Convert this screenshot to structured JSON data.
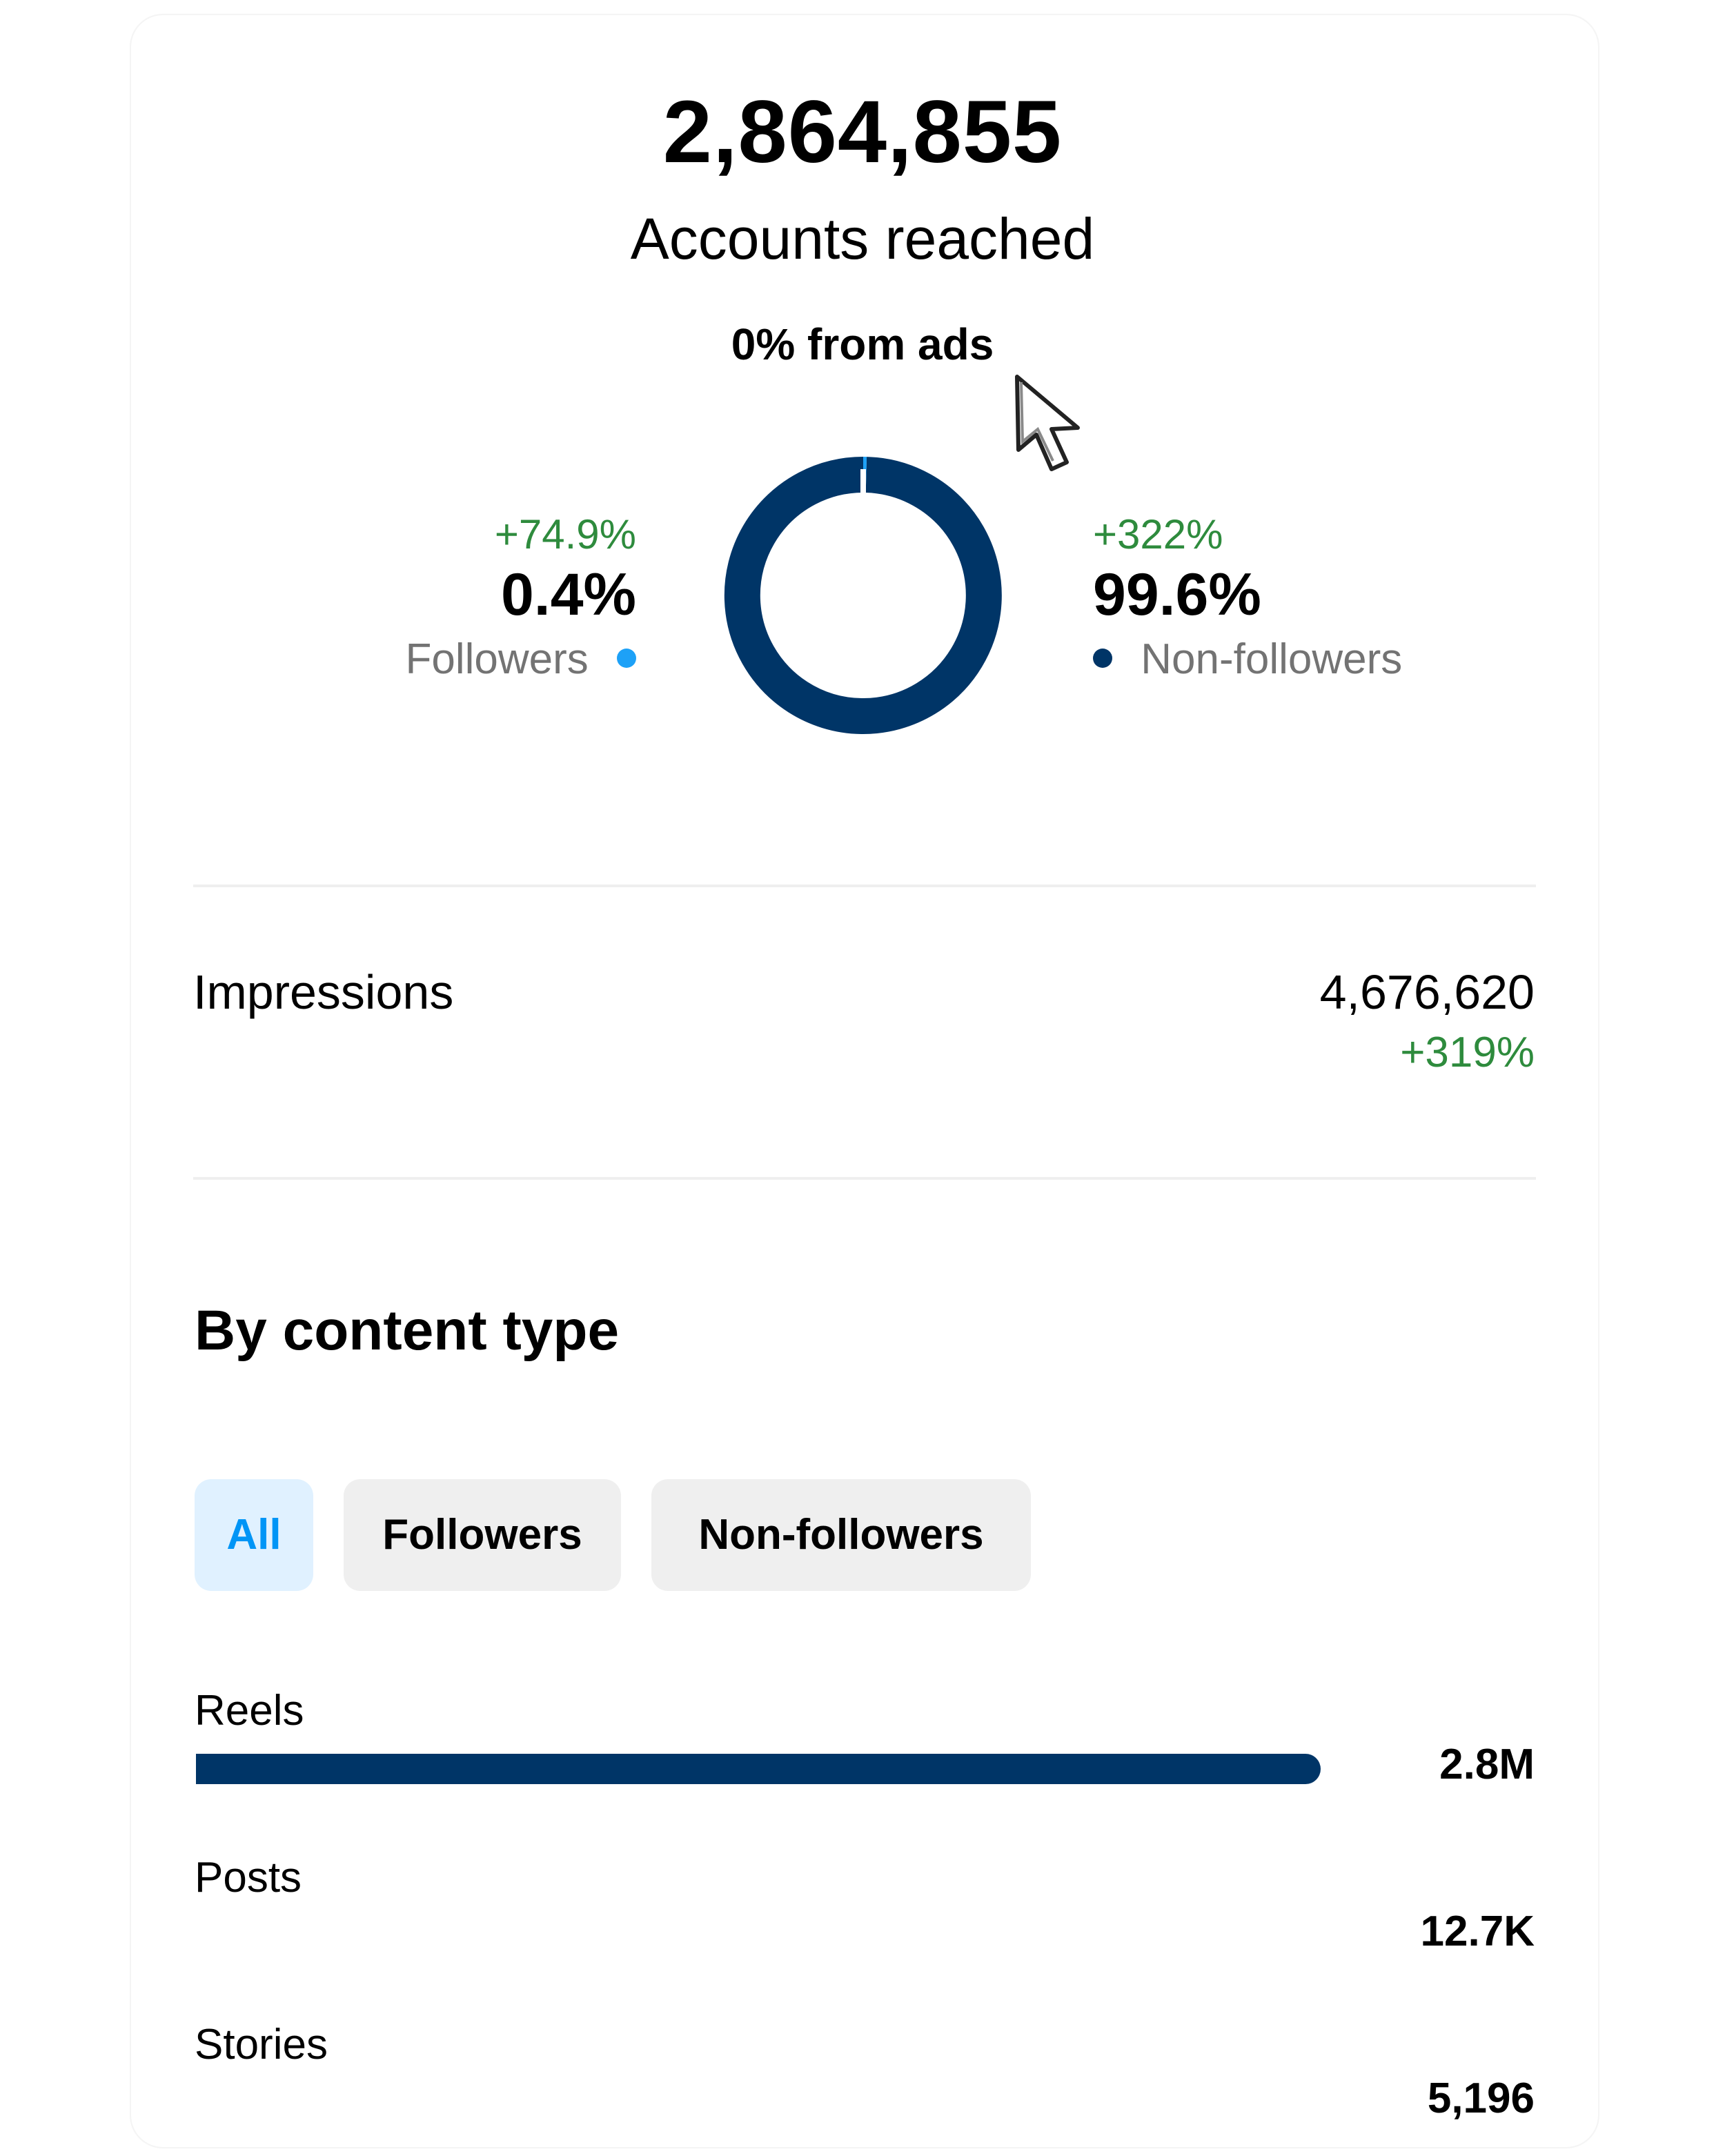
{
  "summary": {
    "accounts_reached_value": "2,864,855",
    "accounts_reached_label": "Accounts reached",
    "ads_note": "0% from ads"
  },
  "reach_split": {
    "followers": {
      "delta": "+74.9%",
      "share": "0.4%",
      "label": "Followers",
      "color": "#1da1f7",
      "fraction": 0.004
    },
    "non_followers": {
      "delta": "+322%",
      "share": "99.6%",
      "label": "Non-followers",
      "color": "#003567",
      "fraction": 0.996
    }
  },
  "impressions": {
    "label": "Impressions",
    "value": "4,676,620",
    "delta": "+319%"
  },
  "content_type": {
    "title": "By content type",
    "filters": [
      {
        "label": "All",
        "active": true
      },
      {
        "label": "Followers",
        "active": false
      },
      {
        "label": "Non-followers",
        "active": false
      }
    ],
    "rows": [
      {
        "label": "Reels",
        "value_label": "2.8M",
        "value": 2800000
      },
      {
        "label": "Posts",
        "value_label": "12.7K",
        "value": 12700
      },
      {
        "label": "Stories",
        "value_label": "5,196",
        "value": 5196
      }
    ],
    "bar_color": "#003567"
  },
  "icons": {
    "cursor": "mouse-pointer-icon",
    "followers_dot": "dot-icon",
    "non_followers_dot": "dot-icon"
  }
}
